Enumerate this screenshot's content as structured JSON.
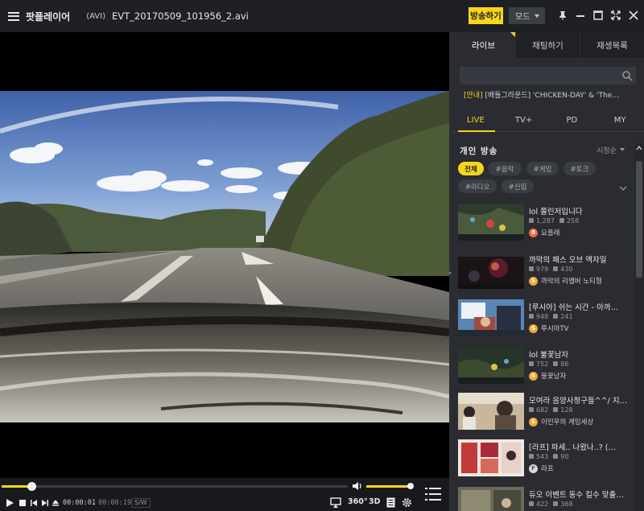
{
  "titlebar": {
    "app_name": "팟플레이어",
    "file_format": "(AVI)",
    "file_name": "EVT_20170509_101956_2.avi",
    "broadcast_label": "방송하기",
    "mode_label": "모드",
    "accent_color": "#f7d51d"
  },
  "controls": {
    "current_time": "00:00:01",
    "separator": "/",
    "total_time": "00:00:19",
    "decoder_badge": "S/W",
    "seek_progress": 0.085,
    "volume_level": 0.96,
    "btn_360": "360°",
    "btn_3d": "3D"
  },
  "sidebar": {
    "tabs": [
      {
        "label": "라이브",
        "active": true
      },
      {
        "label": "채팅하기",
        "active": false
      },
      {
        "label": "재생목록",
        "active": false
      }
    ],
    "notice": {
      "tag": "[안내]",
      "text": " [배틀그라운드] 'CHICKEN-DAY' & 'The…"
    },
    "categories": [
      {
        "label": "LIVE",
        "active": true
      },
      {
        "label": "TV+",
        "active": false
      },
      {
        "label": "PD",
        "active": false
      },
      {
        "label": "MY",
        "active": false
      }
    ],
    "section_title": "개인 방송",
    "sort_label": "시청순",
    "chips": [
      {
        "label": "전체",
        "active": true
      },
      {
        "label": "#음악",
        "active": false
      },
      {
        "label": "#게임",
        "active": false
      },
      {
        "label": "#토크",
        "active": false
      },
      {
        "label": "#라디오",
        "active": false
      },
      {
        "label": "#신입",
        "active": false
      }
    ],
    "items": [
      {
        "title": "lol 쫄린저입니다",
        "viewers": "1,287",
        "likes": "258",
        "bj": "요플래",
        "badge": "8"
      },
      {
        "title": "까막의 패스 오브 엑자일",
        "viewers": "979",
        "likes": "430",
        "bj": "까막의 리멤버 노티형",
        "badge": "S"
      },
      {
        "title": "[루시아] 쉬는 시간 - 아까…",
        "viewers": "948",
        "likes": "241",
        "bj": "루시아TV",
        "badge": "S"
      },
      {
        "title": "lol 불꽃남자",
        "viewers": "752",
        "likes": "86",
        "bj": "불꽃남자",
        "badge": "S"
      },
      {
        "title": "모여라 음양사청구들^^/ 지…",
        "viewers": "682",
        "likes": "128",
        "bj": "이민우의 게임세상",
        "badge": "S"
      },
      {
        "title": "[라프] 파세.. 나왔나..? (…",
        "viewers": "543",
        "likes": "90",
        "bj": "라프",
        "badge": "F"
      },
      {
        "title": "듀오 이벤트 동수 킬수 맞출…",
        "viewers": "422",
        "likes": "368",
        "bj": "",
        "badge": ""
      }
    ]
  }
}
